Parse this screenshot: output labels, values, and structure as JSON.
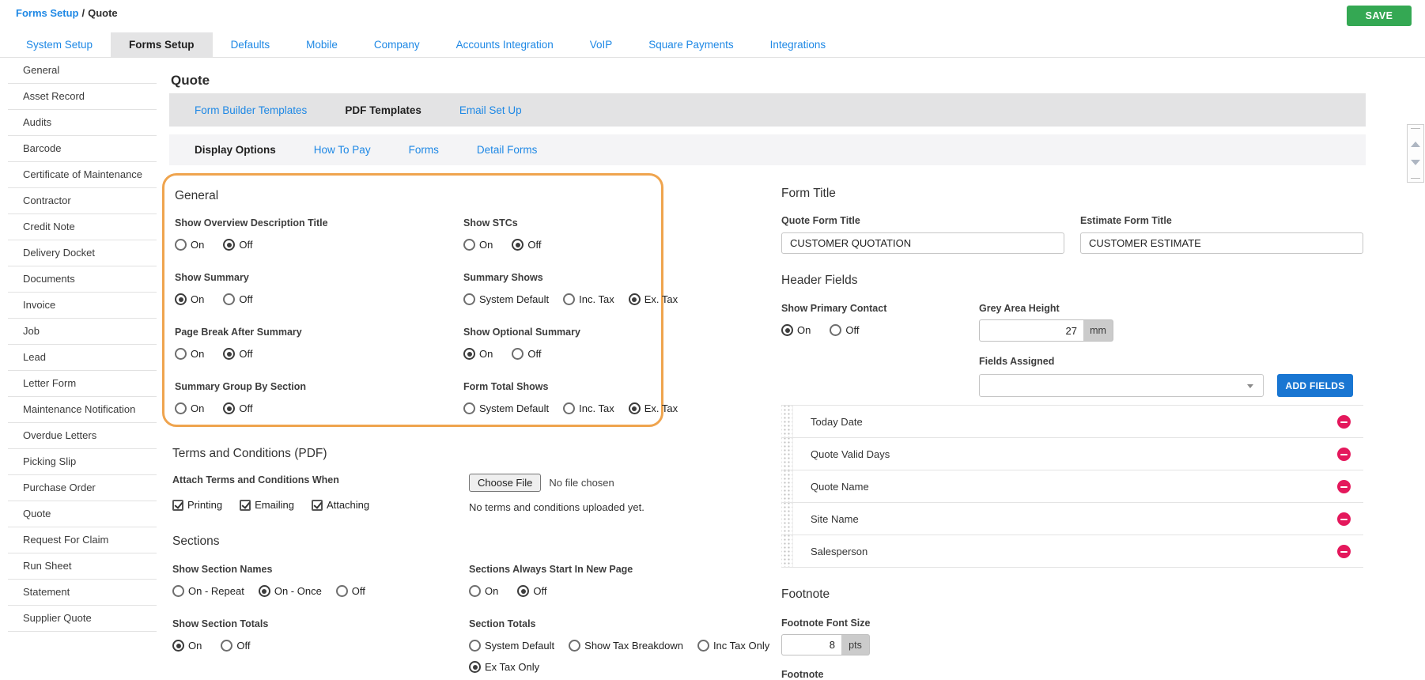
{
  "page": {
    "breadcrumb": {
      "link": "Forms Setup",
      "separator": "/",
      "current": "Quote"
    },
    "save_label": "SAVE"
  },
  "top_tabs": [
    {
      "label": "System Setup",
      "active": false
    },
    {
      "label": "Forms Setup",
      "active": true
    },
    {
      "label": "Defaults",
      "active": false
    },
    {
      "label": "Mobile",
      "active": false
    },
    {
      "label": "Company",
      "active": false
    },
    {
      "label": "Accounts Integration",
      "active": false
    },
    {
      "label": "VoIP",
      "active": false
    },
    {
      "label": "Square Payments",
      "active": false
    },
    {
      "label": "Integrations",
      "active": false
    }
  ],
  "sidebar": {
    "items": [
      "General",
      "Asset Record",
      "Audits",
      "Barcode",
      "Certificate of Maintenance",
      "Contractor",
      "Credit Note",
      "Delivery Docket",
      "Documents",
      "Invoice",
      "Job",
      "Lead",
      "Letter Form",
      "Maintenance Notification",
      "Overdue Letters",
      "Picking Slip",
      "Purchase Order",
      "Quote",
      "Request For Claim",
      "Run Sheet",
      "Statement",
      "Supplier Quote"
    ]
  },
  "main": {
    "title": "Quote",
    "template_tabs": [
      {
        "label": "Form Builder Templates",
        "active": false
      },
      {
        "label": "PDF Templates",
        "active": true
      },
      {
        "label": "Email Set Up",
        "active": false
      }
    ],
    "display_tabs": [
      {
        "label": "Display Options",
        "active": true
      },
      {
        "label": "How To Pay",
        "active": false
      },
      {
        "label": "Forms",
        "active": false
      },
      {
        "label": "Detail Forms",
        "active": false
      }
    ],
    "general": {
      "heading": "General",
      "fields": [
        {
          "label": "Show Overview Description Title",
          "options": [
            {
              "label": "On",
              "selected": false
            },
            {
              "label": "Off",
              "selected": true
            }
          ]
        },
        {
          "label": "Show Summary",
          "options": [
            {
              "label": "On",
              "selected": true
            },
            {
              "label": "Off",
              "selected": false
            }
          ]
        },
        {
          "label": "Page Break After Summary",
          "options": [
            {
              "label": "On",
              "selected": false
            },
            {
              "label": "Off",
              "selected": true
            }
          ]
        },
        {
          "label": "Summary Group By Section",
          "options": [
            {
              "label": "On",
              "selected": false
            },
            {
              "label": "Off",
              "selected": true
            }
          ]
        },
        {
          "label": "Show STCs",
          "options": [
            {
              "label": "On",
              "selected": false
            },
            {
              "label": "Off",
              "selected": true
            }
          ]
        },
        {
          "label": "Summary Shows",
          "options": [
            {
              "label": "System Default",
              "selected": false
            },
            {
              "label": "Inc. Tax",
              "selected": false
            },
            {
              "label": "Ex. Tax",
              "selected": true
            }
          ]
        },
        {
          "label": "Show Optional Summary",
          "options": [
            {
              "label": "On",
              "selected": true
            },
            {
              "label": "Off",
              "selected": false
            }
          ]
        },
        {
          "label": "Form Total Shows",
          "options": [
            {
              "label": "System Default",
              "selected": false
            },
            {
              "label": "Inc. Tax",
              "selected": false
            },
            {
              "label": "Ex. Tax",
              "selected": true
            }
          ]
        }
      ]
    },
    "terms": {
      "heading": "Terms and Conditions (PDF)",
      "attach_label": "Attach Terms and Conditions When",
      "checkboxes": [
        {
          "label": "Printing",
          "checked": true
        },
        {
          "label": "Emailing",
          "checked": true
        },
        {
          "label": "Attaching",
          "checked": true
        }
      ],
      "file_button": "Choose File",
      "file_status": "No file chosen",
      "upload_note": "No terms and conditions uploaded yet."
    },
    "sections": {
      "heading": "Sections",
      "fields": [
        {
          "label": "Show Section Names",
          "options": [
            {
              "label": "On - Repeat",
              "selected": false
            },
            {
              "label": "On - Once",
              "selected": true
            },
            {
              "label": "Off",
              "selected": false
            }
          ]
        },
        {
          "label": "Sections Always Start In New Page",
          "options": [
            {
              "label": "On",
              "selected": false
            },
            {
              "label": "Off",
              "selected": true
            }
          ]
        },
        {
          "label": "Show Section Totals",
          "options": [
            {
              "label": "On",
              "selected": true
            },
            {
              "label": "Off",
              "selected": false
            }
          ]
        },
        {
          "label": "Section Totals",
          "options": [
            {
              "label": "System Default",
              "selected": false
            },
            {
              "label": "Show Tax Breakdown",
              "selected": false
            },
            {
              "label": "Inc Tax Only",
              "selected": false
            },
            {
              "label": "Ex Tax Only",
              "selected": true
            }
          ]
        }
      ]
    }
  },
  "right": {
    "form_title": {
      "heading": "Form Title",
      "quote_label": "Quote Form Title",
      "quote_value": "CUSTOMER QUOTATION",
      "estimate_label": "Estimate Form Title",
      "estimate_value": "CUSTOMER ESTIMATE"
    },
    "header_fields": {
      "heading": "Header Fields",
      "primary_contact": {
        "label": "Show Primary Contact",
        "options": [
          {
            "label": "On",
            "selected": true
          },
          {
            "label": "Off",
            "selected": false
          }
        ]
      },
      "grey_area": {
        "label": "Grey Area Height",
        "value": "27",
        "unit": "mm"
      },
      "fields_assigned_label": "Fields Assigned",
      "add_fields_button": "ADD FIELDS",
      "assigned": [
        "Today Date",
        "Quote Valid Days",
        "Quote Name",
        "Site Name",
        "Salesperson"
      ]
    },
    "footnote": {
      "heading": "Footnote",
      "font_size_label": "Footnote Font Size",
      "font_size_value": "8",
      "font_size_unit": "pts",
      "footnote_label": "Footnote"
    }
  },
  "colors": {
    "link_blue": "#1e88e5",
    "save_green": "#34a853",
    "highlight_orange": "#efa44e",
    "remove_red": "#e4185c",
    "add_button_blue": "#1976d2"
  }
}
